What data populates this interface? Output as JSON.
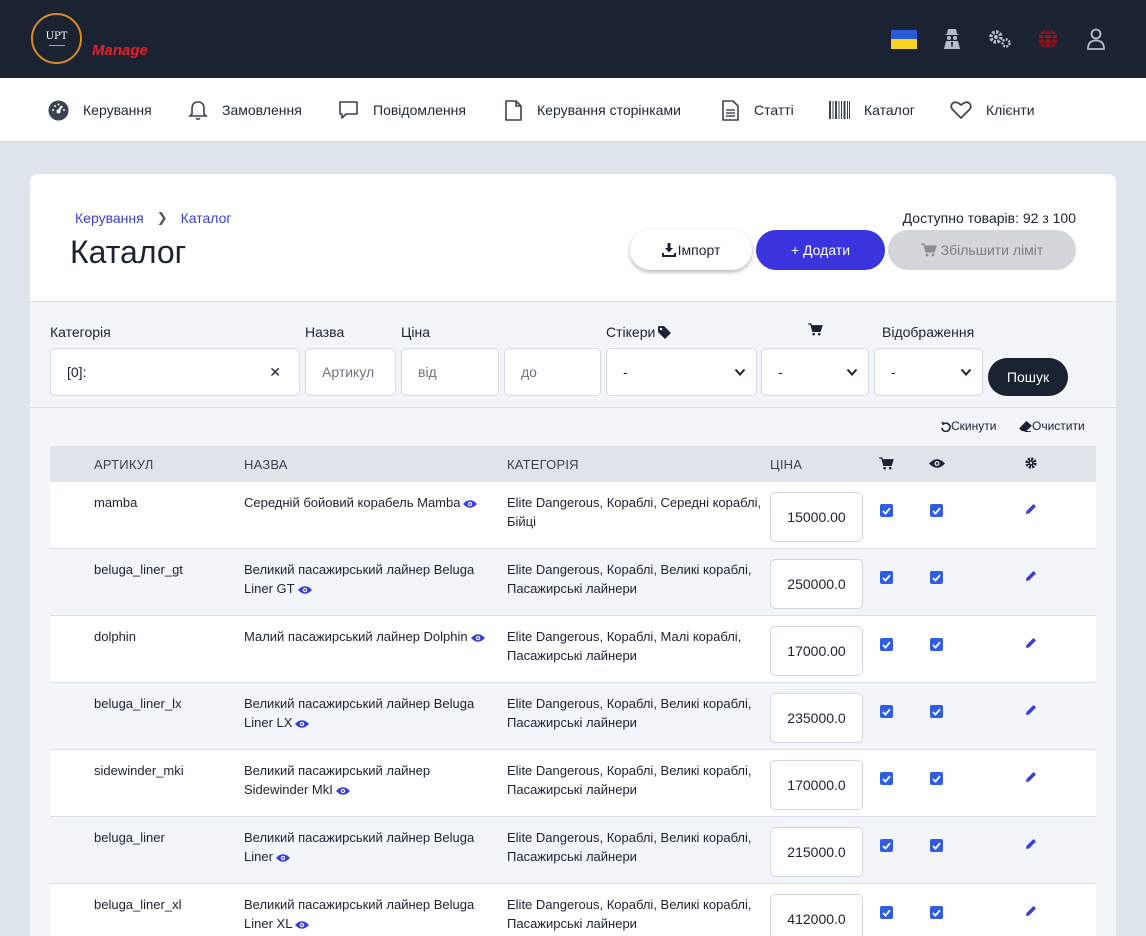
{
  "brand": {
    "logo_text": "UPT",
    "manage_label": "Manage"
  },
  "colors": {
    "accent": "#3a34de",
    "topbar": "#1b2231",
    "brand_red": "#e3202d",
    "checkbox": "#2f5fe0"
  },
  "topbar_icons": [
    "ukraine-flag",
    "spy-icon",
    "gears-icon",
    "globe-icon",
    "user-icon"
  ],
  "nav": {
    "items": [
      {
        "label": "Керування",
        "icon": "dashboard-icon"
      },
      {
        "label": "Замовлення",
        "icon": "bell-icon"
      },
      {
        "label": "Повідомлення",
        "icon": "message-icon"
      },
      {
        "label": "Керування сторінками",
        "icon": "file-icon"
      },
      {
        "label": "Статті",
        "icon": "article-icon"
      },
      {
        "label": "Каталог",
        "icon": "barcode-icon"
      },
      {
        "label": "Клієнти",
        "icon": "heart-icon"
      }
    ]
  },
  "breadcrumb": {
    "home": "Керування",
    "current": "Каталог"
  },
  "page": {
    "title": "Каталог",
    "available": "Доступно товарів: 92 з 100",
    "import_label": "Імпорт",
    "add_label": "+ Додати",
    "limit_label": "Збільшити ліміт"
  },
  "filters": {
    "category_label": "Категорія",
    "category_value": "[0]:",
    "name_label": "Назва",
    "name_placeholder": "Артикул",
    "price_label": "Ціна",
    "price_from_placeholder": "від",
    "price_to_placeholder": "до",
    "stickers_label": "Стікери",
    "stickers_value": "-",
    "cart_value": "-",
    "display_label": "Відображення",
    "display_value": "-",
    "search_label": "Пошук",
    "reset_label": "Скинути",
    "clear_label": "Очистити"
  },
  "table": {
    "headers": {
      "sku": "АРТИКУЛ",
      "name": "НАЗВА",
      "category": "КАТЕГОРІЯ",
      "price": "ЦІНА"
    },
    "rows": [
      {
        "sku": "mamba",
        "name1": "Середній бойовий корабель Mamba",
        "name2": "",
        "cat1": "Elite Dangerous, Кораблі, Середні кораблі,",
        "cat2": "Бійці",
        "price": "15000.00",
        "in_cart": true,
        "visible": true
      },
      {
        "sku": "beluga_liner_gt",
        "name1": "Великий пасажирський лайнер Beluga",
        "name2": "Liner GT",
        "cat1": "Elite Dangerous, Кораблі, Великі кораблі,",
        "cat2": "Пасажирські лайнери",
        "price": "250000.0",
        "in_cart": true,
        "visible": true
      },
      {
        "sku": "dolphin",
        "name1": "Малий пасажирський лайнер Dolphin",
        "name2": "",
        "cat1": "Elite Dangerous, Кораблі, Малі кораблі,",
        "cat2": "Пасажирські лайнери",
        "price": "17000.00",
        "in_cart": true,
        "visible": true
      },
      {
        "sku": "beluga_liner_lx",
        "name1": "Великий пасажирський лайнер Beluga",
        "name2": "Liner LX",
        "cat1": "Elite Dangerous, Кораблі, Великі кораблі,",
        "cat2": "Пасажирські лайнери",
        "price": "235000.0",
        "in_cart": true,
        "visible": true
      },
      {
        "sku": "sidewinder_mki",
        "name1": "Великий пасажирський лайнер",
        "name2": "Sidewinder MkI",
        "cat1": "Elite Dangerous, Кораблі, Великі кораблі,",
        "cat2": "Пасажирські лайнери",
        "price": "170000.0",
        "in_cart": true,
        "visible": true
      },
      {
        "sku": "beluga_liner",
        "name1": "Великий пасажирський лайнер Beluga",
        "name2": "Liner",
        "cat1": "Elite Dangerous, Кораблі, Великі кораблі,",
        "cat2": "Пасажирські лайнери",
        "price": "215000.0",
        "in_cart": true,
        "visible": true
      },
      {
        "sku": "beluga_liner_xl",
        "name1": "Великий пасажирський лайнер Beluga",
        "name2": "Liner XL",
        "cat1": "Elite Dangerous, Кораблі, Великі кораблі,",
        "cat2": "Пасажирські лайнери",
        "price": "412000.0",
        "in_cart": true,
        "visible": true
      }
    ]
  }
}
